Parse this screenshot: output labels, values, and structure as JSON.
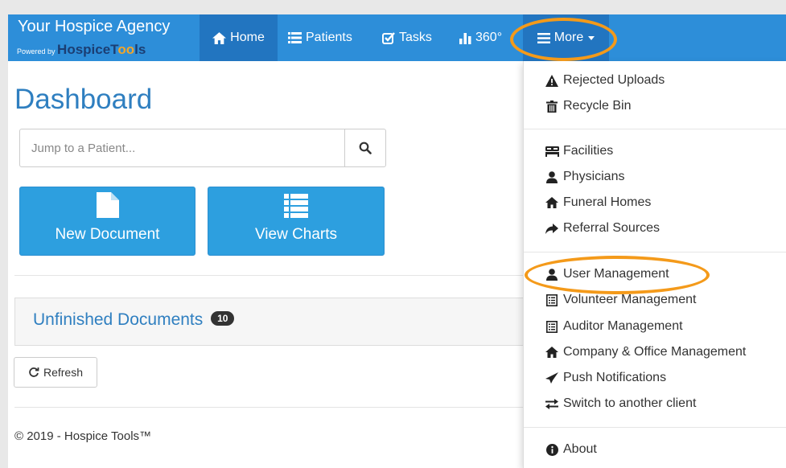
{
  "brand": {
    "title": "Your Hospice Agency",
    "powered_by": "Powered by",
    "logo_part1": "HospiceT",
    "logo_part2": "oo",
    "logo_part3": "ls"
  },
  "nav": {
    "home": "Home",
    "patients": "Patients",
    "tasks": "Tasks",
    "stats": "360°",
    "more": "More"
  },
  "main": {
    "title": "Dashboard",
    "search_placeholder": "Jump to a Patient...",
    "new_document": "New Document",
    "view_charts": "View Charts",
    "unfinished_documents": "Unfinished Documents",
    "unfinished_count": "10",
    "refresh": "Refresh",
    "footer": "© 2019 - Hospice Tools™"
  },
  "menu": {
    "rejected_uploads": "Rejected Uploads",
    "recycle_bin": "Recycle Bin",
    "facilities": "Facilities",
    "physicians": "Physicians",
    "funeral_homes": "Funeral Homes",
    "referral_sources": "Referral Sources",
    "user_management": "User Management",
    "volunteer_management": "Volunteer Management",
    "auditor_management": "Auditor Management",
    "company_office_management": "Company & Office Management",
    "push_notifications": "Push Notifications",
    "switch_client": "Switch to another client",
    "about": "About"
  },
  "colors": {
    "navbar": "#2d8ed9",
    "navbar_active": "#2275c0",
    "title_blue": "#2f7fc0",
    "button_blue": "#2d9fdf",
    "highlight_orange": "#f49a1a"
  }
}
